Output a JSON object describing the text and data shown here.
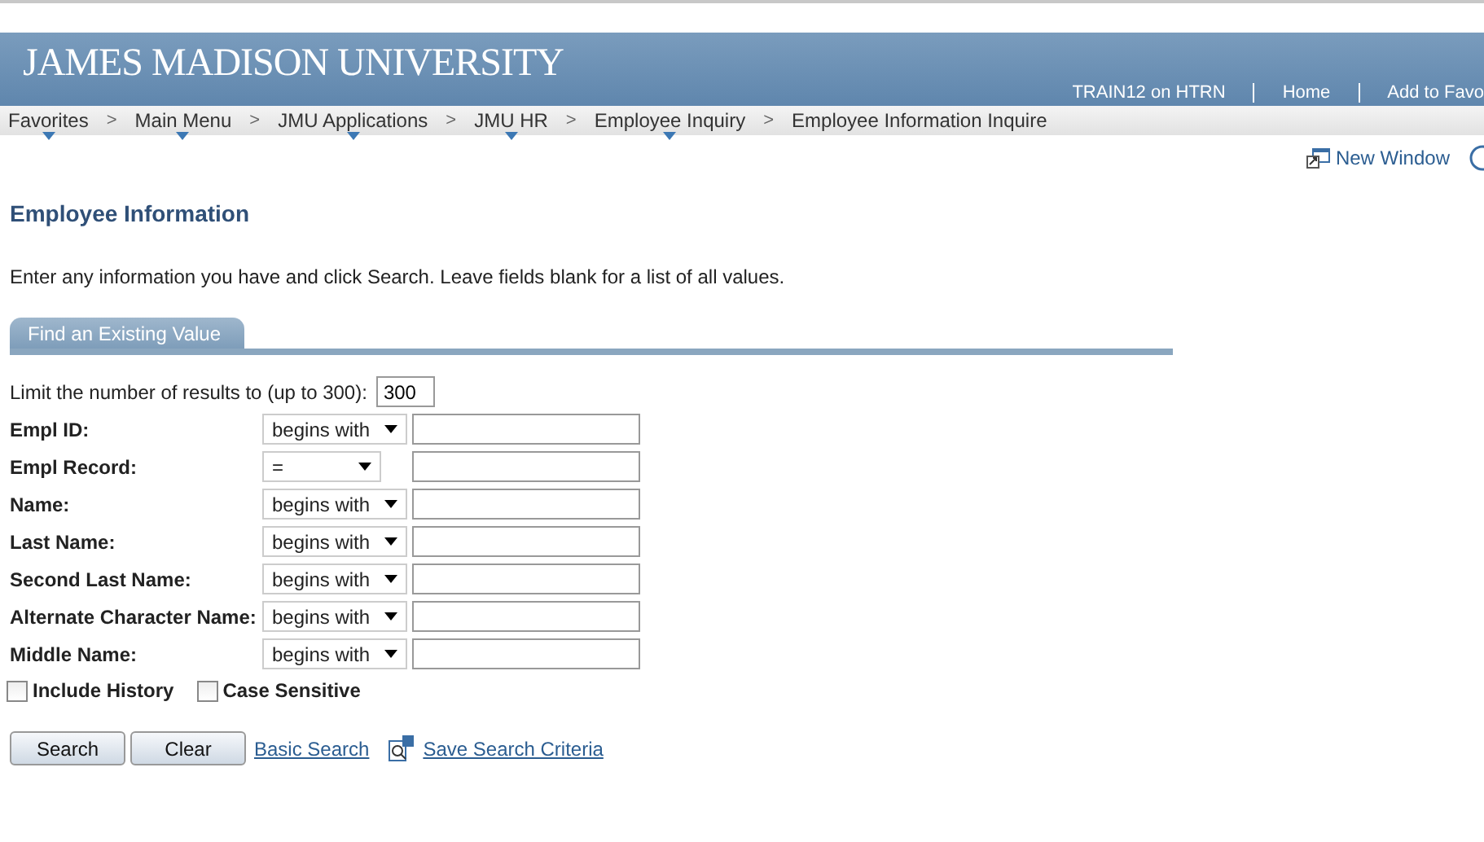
{
  "header": {
    "logo": "JAMES MADISON UNIVERSITY",
    "links": [
      "TRAIN12 on HTRN",
      "Home",
      "Add to Favo"
    ]
  },
  "nav": {
    "items": [
      {
        "label": "Favorites",
        "menu": true
      },
      {
        "label": "Main Menu",
        "menu": true
      },
      {
        "label": "JMU Applications",
        "menu": true
      },
      {
        "label": "JMU HR",
        "menu": true
      },
      {
        "label": "Employee Inquiry",
        "menu": true
      },
      {
        "label": "Employee Information Inquire",
        "menu": false
      }
    ],
    "separator": ">"
  },
  "toolbar": {
    "new_window": "New Window"
  },
  "page_title": "Employee Information",
  "instructions": "Enter any information you have and click Search. Leave fields blank for a list of all values.",
  "tab": "Find an Existing Value",
  "limit": {
    "label": "Limit the number of results to (up to 300):",
    "value": "300"
  },
  "fields": [
    {
      "label": "Empl ID:",
      "operator": "begins with",
      "kind": "text"
    },
    {
      "label": "Empl Record:",
      "operator": "=",
      "kind": "number"
    },
    {
      "label": "Name:",
      "operator": "begins with",
      "kind": "text"
    },
    {
      "label": "Last Name:",
      "operator": "begins with",
      "kind": "text"
    },
    {
      "label": "Second Last Name:",
      "operator": "begins with",
      "kind": "text"
    },
    {
      "label": "Alternate Character Name:",
      "operator": "begins with",
      "kind": "text"
    },
    {
      "label": "Middle Name:",
      "operator": "begins with",
      "kind": "text"
    }
  ],
  "options": [
    {
      "label": "Include History",
      "checked": false
    },
    {
      "label": "Case Sensitive",
      "checked": false
    }
  ],
  "buttons": [
    "Search",
    "Clear"
  ],
  "links": {
    "basic": "Basic Search",
    "save": "Save Search Criteria"
  }
}
